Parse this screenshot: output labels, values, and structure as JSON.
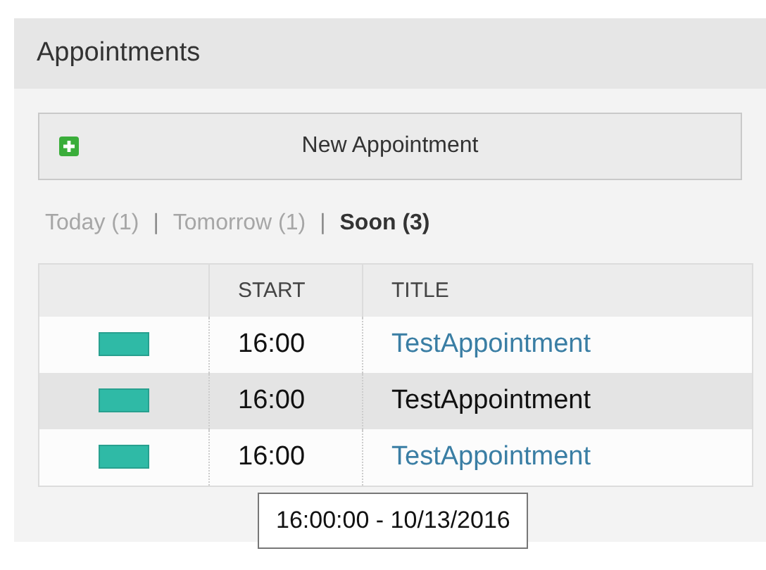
{
  "panel": {
    "title": "Appointments"
  },
  "new_button": {
    "label": "New Appointment"
  },
  "filters": [
    {
      "label": "Today (1)",
      "selected": false
    },
    {
      "label": "Tomorrow (1)",
      "selected": false
    },
    {
      "label": "Soon (3)",
      "selected": true
    }
  ],
  "filter_separator": "|",
  "table": {
    "columns": [
      "START",
      "TITLE"
    ],
    "rows": [
      {
        "start": "16:00",
        "title": "TestAppointment",
        "hovered": false
      },
      {
        "start": "16:00",
        "title": "TestAppointment",
        "hovered": true
      },
      {
        "start": "16:00",
        "title": "TestAppointment",
        "hovered": false
      }
    ]
  },
  "tooltip": "16:00:00 - 10/13/2016"
}
